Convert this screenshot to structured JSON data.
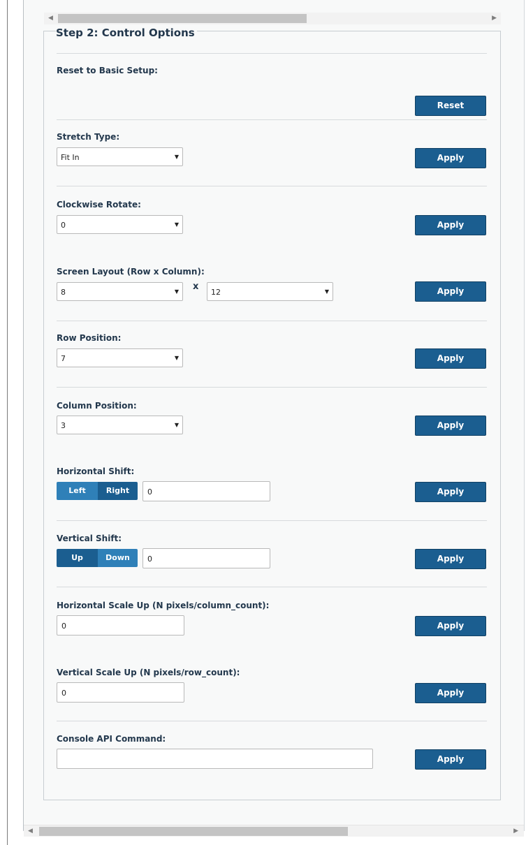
{
  "legend": "Step 2: Control Options",
  "reset_section": {
    "label": "Reset to Basic Setup:",
    "button": "Reset"
  },
  "stretch": {
    "label": "Stretch Type:",
    "selected": "Fit In",
    "button": "Apply"
  },
  "rotate": {
    "label": "Clockwise Rotate:",
    "selected": "0",
    "button": "Apply"
  },
  "layout": {
    "label": "Screen Layout (Row x Column):",
    "rows": "8",
    "separator": "x",
    "columns": "12",
    "button": "Apply"
  },
  "row_position": {
    "label": "Row Position:",
    "selected": "7",
    "button": "Apply"
  },
  "column_position": {
    "label": "Column Position:",
    "selected": "3",
    "button": "Apply"
  },
  "horizontal_shift": {
    "label": "Horizontal Shift:",
    "left": "Left",
    "right": "Right",
    "value": "0",
    "button": "Apply"
  },
  "vertical_shift": {
    "label": "Vertical Shift:",
    "up": "Up",
    "down": "Down",
    "value": "0",
    "button": "Apply"
  },
  "horizontal_scale": {
    "label": "Horizontal Scale Up (N pixels/column_count):",
    "value": "0",
    "button": "Apply"
  },
  "vertical_scale": {
    "label": "Vertical Scale Up (N pixels/row_count):",
    "value": "0",
    "button": "Apply"
  },
  "console": {
    "label": "Console API Command:",
    "value": "",
    "button": "Apply"
  },
  "icons": {
    "scroll_left": "◀",
    "scroll_right": "▶",
    "dropdown": "▼"
  },
  "colors": {
    "button_blue": "#1b5e90",
    "segment_light": "#2f80b8",
    "label_text": "#23384d"
  }
}
